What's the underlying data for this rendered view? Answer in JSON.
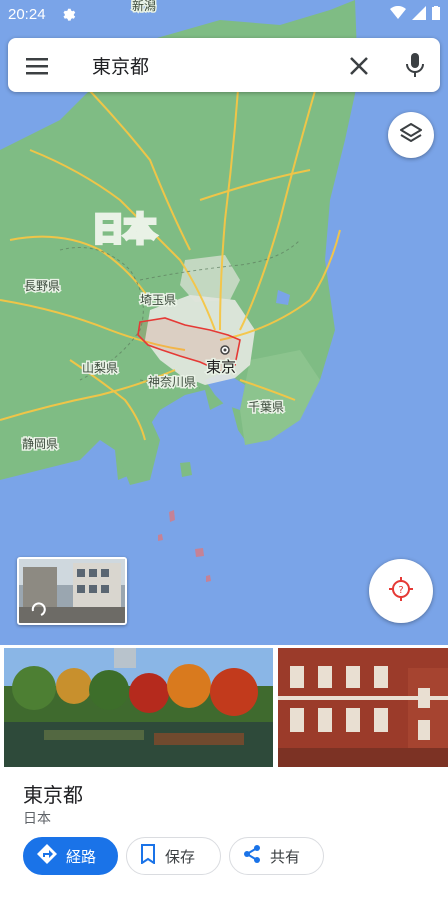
{
  "status_bar": {
    "time": "20:24"
  },
  "search": {
    "query": "東京都"
  },
  "map": {
    "country_label": "日本",
    "labels": [
      "長野県",
      "埼玉県",
      "山梨県",
      "神奈川県",
      "東京",
      "千葉県",
      "静岡県"
    ],
    "top_label": "新潟"
  },
  "place": {
    "name": "東京都",
    "country": "日本"
  },
  "actions": {
    "route": "経路",
    "save": "保存",
    "share": "共有"
  },
  "colors": {
    "accent": "#1a73e8",
    "sea": "#7aa4e8",
    "land": "#7ab87f",
    "urban": "#ececec",
    "road": "#f6c645",
    "highlight": "#e53935"
  },
  "icons": {
    "menu": "menu-icon",
    "clear": "close-icon",
    "mic": "mic-icon",
    "layers": "layers-icon",
    "locate": "my-location-icon",
    "route": "directions-icon",
    "save": "bookmark-icon",
    "share": "share-icon"
  }
}
